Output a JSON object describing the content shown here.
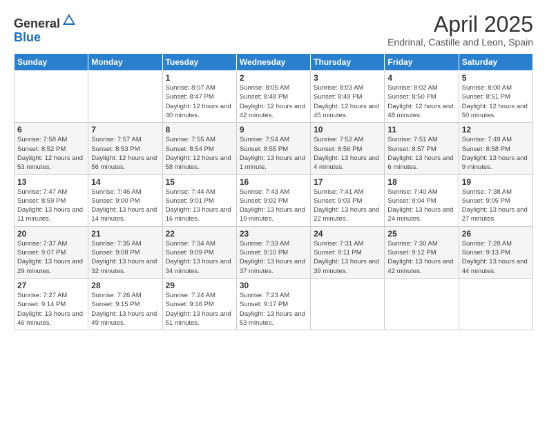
{
  "logo": {
    "general": "General",
    "blue": "Blue"
  },
  "title": "April 2025",
  "subtitle": "Endrinal, Castille and Leon, Spain",
  "days_header": [
    "Sunday",
    "Monday",
    "Tuesday",
    "Wednesday",
    "Thursday",
    "Friday",
    "Saturday"
  ],
  "weeks": [
    [
      null,
      null,
      {
        "day": 1,
        "sunrise": "8:07 AM",
        "sunset": "8:47 PM",
        "daylight": "12 hours and 40 minutes."
      },
      {
        "day": 2,
        "sunrise": "8:05 AM",
        "sunset": "8:48 PM",
        "daylight": "12 hours and 42 minutes."
      },
      {
        "day": 3,
        "sunrise": "8:03 AM",
        "sunset": "8:49 PM",
        "daylight": "12 hours and 45 minutes."
      },
      {
        "day": 4,
        "sunrise": "8:02 AM",
        "sunset": "8:50 PM",
        "daylight": "12 hours and 48 minutes."
      },
      {
        "day": 5,
        "sunrise": "8:00 AM",
        "sunset": "8:51 PM",
        "daylight": "12 hours and 50 minutes."
      }
    ],
    [
      {
        "day": 6,
        "sunrise": "7:58 AM",
        "sunset": "8:52 PM",
        "daylight": "12 hours and 53 minutes."
      },
      {
        "day": 7,
        "sunrise": "7:57 AM",
        "sunset": "8:53 PM",
        "daylight": "12 hours and 56 minutes."
      },
      {
        "day": 8,
        "sunrise": "7:55 AM",
        "sunset": "8:54 PM",
        "daylight": "12 hours and 58 minutes."
      },
      {
        "day": 9,
        "sunrise": "7:54 AM",
        "sunset": "8:55 PM",
        "daylight": "13 hours and 1 minute."
      },
      {
        "day": 10,
        "sunrise": "7:52 AM",
        "sunset": "8:56 PM",
        "daylight": "13 hours and 4 minutes."
      },
      {
        "day": 11,
        "sunrise": "7:51 AM",
        "sunset": "8:57 PM",
        "daylight": "13 hours and 6 minutes."
      },
      {
        "day": 12,
        "sunrise": "7:49 AM",
        "sunset": "8:58 PM",
        "daylight": "13 hours and 9 minutes."
      }
    ],
    [
      {
        "day": 13,
        "sunrise": "7:47 AM",
        "sunset": "8:59 PM",
        "daylight": "13 hours and 11 minutes."
      },
      {
        "day": 14,
        "sunrise": "7:46 AM",
        "sunset": "9:00 PM",
        "daylight": "13 hours and 14 minutes."
      },
      {
        "day": 15,
        "sunrise": "7:44 AM",
        "sunset": "9:01 PM",
        "daylight": "13 hours and 16 minutes."
      },
      {
        "day": 16,
        "sunrise": "7:43 AM",
        "sunset": "9:02 PM",
        "daylight": "13 hours and 19 minutes."
      },
      {
        "day": 17,
        "sunrise": "7:41 AM",
        "sunset": "9:03 PM",
        "daylight": "13 hours and 22 minutes."
      },
      {
        "day": 18,
        "sunrise": "7:40 AM",
        "sunset": "9:04 PM",
        "daylight": "13 hours and 24 minutes."
      },
      {
        "day": 19,
        "sunrise": "7:38 AM",
        "sunset": "9:05 PM",
        "daylight": "13 hours and 27 minutes."
      }
    ],
    [
      {
        "day": 20,
        "sunrise": "7:37 AM",
        "sunset": "9:07 PM",
        "daylight": "13 hours and 29 minutes."
      },
      {
        "day": 21,
        "sunrise": "7:35 AM",
        "sunset": "9:08 PM",
        "daylight": "13 hours and 32 minutes."
      },
      {
        "day": 22,
        "sunrise": "7:34 AM",
        "sunset": "9:09 PM",
        "daylight": "13 hours and 34 minutes."
      },
      {
        "day": 23,
        "sunrise": "7:33 AM",
        "sunset": "9:10 PM",
        "daylight": "13 hours and 37 minutes."
      },
      {
        "day": 24,
        "sunrise": "7:31 AM",
        "sunset": "9:11 PM",
        "daylight": "13 hours and 39 minutes."
      },
      {
        "day": 25,
        "sunrise": "7:30 AM",
        "sunset": "9:12 PM",
        "daylight": "13 hours and 42 minutes."
      },
      {
        "day": 26,
        "sunrise": "7:28 AM",
        "sunset": "9:13 PM",
        "daylight": "13 hours and 44 minutes."
      }
    ],
    [
      {
        "day": 27,
        "sunrise": "7:27 AM",
        "sunset": "9:14 PM",
        "daylight": "13 hours and 46 minutes."
      },
      {
        "day": 28,
        "sunrise": "7:26 AM",
        "sunset": "9:15 PM",
        "daylight": "13 hours and 49 minutes."
      },
      {
        "day": 29,
        "sunrise": "7:24 AM",
        "sunset": "9:16 PM",
        "daylight": "13 hours and 51 minutes."
      },
      {
        "day": 30,
        "sunrise": "7:23 AM",
        "sunset": "9:17 PM",
        "daylight": "13 hours and 53 minutes."
      },
      null,
      null,
      null
    ]
  ],
  "labels": {
    "sunrise": "Sunrise:",
    "sunset": "Sunset:",
    "daylight": "Daylight:"
  }
}
